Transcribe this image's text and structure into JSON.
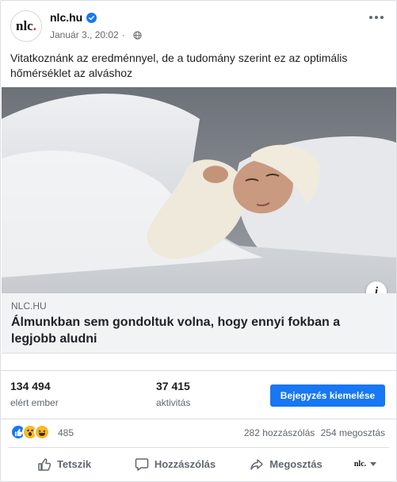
{
  "post": {
    "page_name": "nlc.hu",
    "avatar_text": "nlc",
    "avatar_dot": ".",
    "timestamp": "Január 3., 20:02",
    "privacy_icon": "globe-icon",
    "text": "Vitatkoznánk az eredménnyel, de a tudomány szerint ez az optimális hőmérséklet az alváshoz"
  },
  "link": {
    "domain": "NLC.HU",
    "title": "Álmunkban sem gondoltuk volna, hogy ennyi fokban a legjobb aludni"
  },
  "insights": {
    "reach_value": "134 494",
    "reach_label": "elért ember",
    "engagement_value": "37 415",
    "engagement_label": "aktivitás",
    "boost_label": "Bejegyzés kiemelése"
  },
  "reactions": {
    "icons": [
      "like-icon",
      "wow-icon",
      "haha-icon"
    ],
    "count": "485",
    "comments": "282 hozzászólás",
    "shares": "254 megosztás"
  },
  "actions": {
    "like": "Tetszik",
    "comment": "Hozzászólás",
    "share": "Megosztás",
    "page_selector": "nlc."
  },
  "colors": {
    "accent": "#1877f2",
    "brand_dot": "#e2231a"
  }
}
